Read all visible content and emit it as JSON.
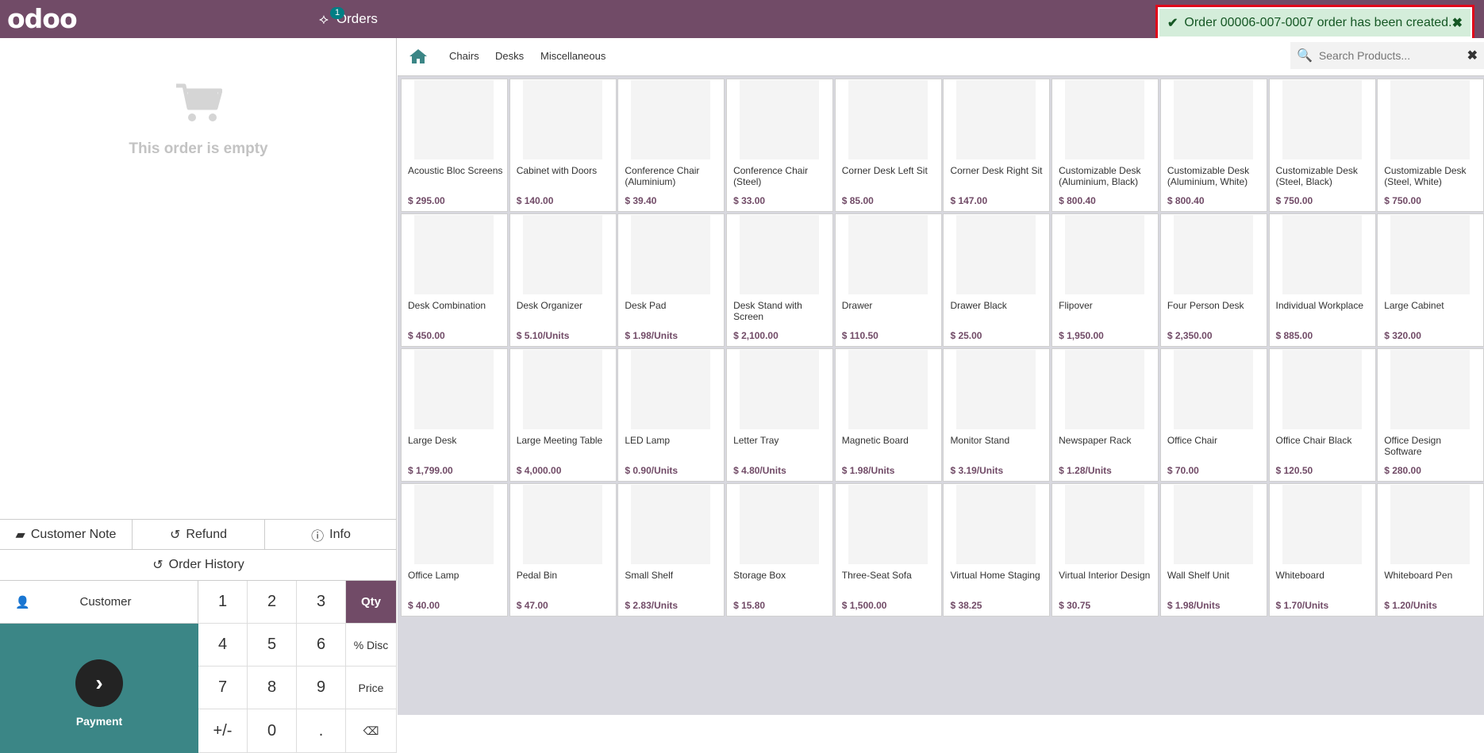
{
  "header": {
    "logo": "odoo",
    "orders_label": "Orders",
    "orders_badge": "1"
  },
  "toast": {
    "message": "Order 00006-007-0007 order has been created."
  },
  "order": {
    "empty_text": "This order is empty"
  },
  "actions": {
    "customer_note": "Customer Note",
    "refund": "Refund",
    "info": "Info",
    "order_history": "Order History",
    "customer": "Customer",
    "payment": "Payment"
  },
  "numpad": [
    "1",
    "2",
    "3",
    "Qty",
    "4",
    "5",
    "6",
    "% Disc",
    "7",
    "8",
    "9",
    "Price",
    "+/-",
    "0",
    ".",
    "⌫"
  ],
  "categories": [
    "Chairs",
    "Desks",
    "Miscellaneous"
  ],
  "search": {
    "placeholder": "Search Products..."
  },
  "products": [
    {
      "name": "Acoustic Bloc Screens",
      "price": "$ 295.00"
    },
    {
      "name": "Cabinet with Doors",
      "price": "$ 140.00"
    },
    {
      "name": "Conference Chair (Aluminium)",
      "price": "$ 39.40"
    },
    {
      "name": "Conference Chair (Steel)",
      "price": "$ 33.00"
    },
    {
      "name": "Corner Desk Left Sit",
      "price": "$ 85.00"
    },
    {
      "name": "Corner Desk Right Sit",
      "price": "$ 147.00"
    },
    {
      "name": "Customizable Desk (Aluminium, Black)",
      "price": "$ 800.40"
    },
    {
      "name": "Customizable Desk (Aluminium, White)",
      "price": "$ 800.40"
    },
    {
      "name": "Customizable Desk (Steel, Black)",
      "price": "$ 750.00"
    },
    {
      "name": "Customizable Desk (Steel, White)",
      "price": "$ 750.00"
    },
    {
      "name": "Desk Combination",
      "price": "$ 450.00"
    },
    {
      "name": "Desk Organizer",
      "price": "$ 5.10/Units"
    },
    {
      "name": "Desk Pad",
      "price": "$ 1.98/Units"
    },
    {
      "name": "Desk Stand with Screen",
      "price": "$ 2,100.00"
    },
    {
      "name": "Drawer",
      "price": "$ 110.50"
    },
    {
      "name": "Drawer Black",
      "price": "$ 25.00"
    },
    {
      "name": "Flipover",
      "price": "$ 1,950.00"
    },
    {
      "name": "Four Person Desk",
      "price": "$ 2,350.00"
    },
    {
      "name": "Individual Workplace",
      "price": "$ 885.00"
    },
    {
      "name": "Large Cabinet",
      "price": "$ 320.00"
    },
    {
      "name": "Large Desk",
      "price": "$ 1,799.00"
    },
    {
      "name": "Large Meeting Table",
      "price": "$ 4,000.00"
    },
    {
      "name": "LED Lamp",
      "price": "$ 0.90/Units"
    },
    {
      "name": "Letter Tray",
      "price": "$ 4.80/Units"
    },
    {
      "name": "Magnetic Board",
      "price": "$ 1.98/Units"
    },
    {
      "name": "Monitor Stand",
      "price": "$ 3.19/Units"
    },
    {
      "name": "Newspaper Rack",
      "price": "$ 1.28/Units"
    },
    {
      "name": "Office Chair",
      "price": "$ 70.00"
    },
    {
      "name": "Office Chair Black",
      "price": "$ 120.50"
    },
    {
      "name": "Office Design Software",
      "price": "$ 280.00"
    },
    {
      "name": "Office Lamp",
      "price": "$ 40.00"
    },
    {
      "name": "Pedal Bin",
      "price": "$ 47.00"
    },
    {
      "name": "Small Shelf",
      "price": "$ 2.83/Units"
    },
    {
      "name": "Storage Box",
      "price": "$ 15.80"
    },
    {
      "name": "Three-Seat Sofa",
      "price": "$ 1,500.00"
    },
    {
      "name": "Virtual Home Staging",
      "price": "$ 38.25"
    },
    {
      "name": "Virtual Interior Design",
      "price": "$ 30.75"
    },
    {
      "name": "Wall Shelf Unit",
      "price": "$ 1.98/Units"
    },
    {
      "name": "Whiteboard",
      "price": "$ 1.70/Units"
    },
    {
      "name": "Whiteboard Pen",
      "price": "$ 1.20/Units"
    }
  ],
  "colors": {
    "brand": "#714b67",
    "teal": "#3b8686",
    "toast_bg": "#d4edda",
    "toast_border": "#e0071b"
  }
}
